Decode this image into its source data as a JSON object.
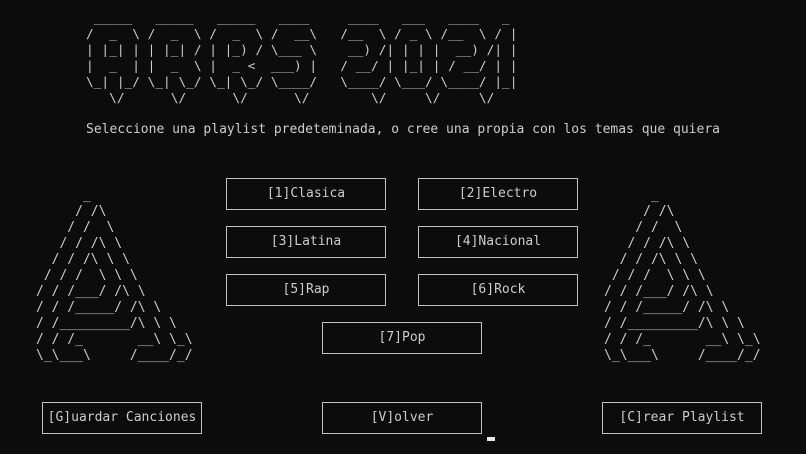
{
  "title_art": " _____   _____   _____   ____     ____   ___   ____   _ \n/  _  \\ /  _  \\ /  _  \\ /  __\\   /__  \\ / _ \\ /__  \\ / |\n| |_| | | |_| / | |_) / \\___ \\    __) /| | | |  __) /| |\n|  _  | |  _  \\ |  _ <  ___) |   / __/ | |_| | / __/ | |\n\\_| |_/ \\_| \\_/ \\_| \\_/ \\____/   \\____/ \\___/ \\____/ |_|\n   \\/      \\/      \\/      \\/        \\/     \\/     \\/",
  "subtitle": "Seleccione una playlist predeteminada, o cree una propia con los temas que quiera",
  "left_art": "      _\n     / /\\\n    / /  \\\n   / / /\\ \\\n  / / /\\ \\ \\\n / / /  \\ \\ \\\n/ / /___/ /\\ \\\n/ / /_____/ /\\ \\\n/ /_________/\\ \\ \\\n/ / /_       __\\ \\_\\\n\\_\\___\\     /____/_/",
  "right_art": "      _\n     / /\\\n    / /  \\\n   / / /\\ \\\n  / / /\\ \\ \\\n / / /  \\ \\ \\\n/ / /___/ /\\ \\\n/ / /_____/ /\\ \\\n/ /_________/\\ \\ \\\n/ / /_       __\\ \\_\\\n\\_\\___\\     /____/_/",
  "playlists": {
    "clasica": "[1]Clasica",
    "electro": "[2]Electro",
    "latina": "[3]Latina",
    "nacional": "[4]Nacional",
    "rap": "[5]Rap",
    "rock": "[6]Rock",
    "pop": "[7]Pop"
  },
  "actions": {
    "guardar": "[G]uardar Canciones",
    "volver": "[V]olver",
    "crear": "[C]rear Playlist"
  }
}
